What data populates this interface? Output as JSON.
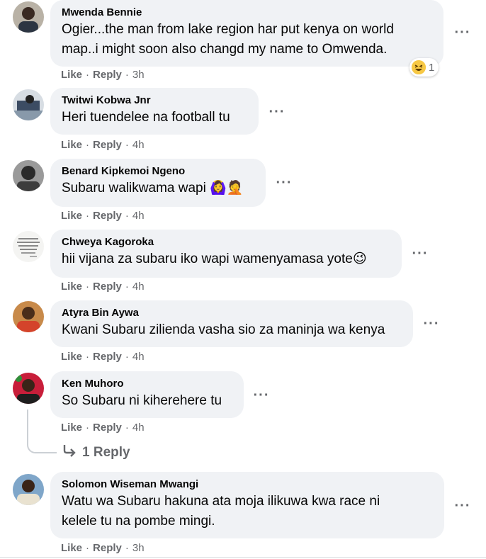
{
  "comments": [
    {
      "author": "Mwenda Bennie",
      "text_lines": [
        "Ogier...the man from lake region har put kenya on world",
        "map..i might soon also changd my name to Omwenda."
      ],
      "like": "Like",
      "reply": "Reply",
      "time": "3h",
      "reaction": {
        "icon": "laughing-emoji",
        "count": "1"
      }
    },
    {
      "author": "Twitwi Kobwa Jnr",
      "text_lines": [
        "Heri tuendelee na football tu"
      ],
      "like": "Like",
      "reply": "Reply",
      "time": "4h"
    },
    {
      "author": "Benard Kipkemoi Ngeno",
      "text_lines": [
        "Subaru walikwama wapi 🙆‍♀️🤦"
      ],
      "like": "Like",
      "reply": "Reply",
      "time": "4h"
    },
    {
      "author": "Chweya Kagoroka",
      "text_lines": [
        "hii vijana za subaru iko wapi wamenyamasa yote😉"
      ],
      "like": "Like",
      "reply": "Reply",
      "time": "4h"
    },
    {
      "author": "Atyra Bin Aywa",
      "text_lines": [
        "Kwani Subaru zilienda vasha sio za maninja wa kenya"
      ],
      "like": "Like",
      "reply": "Reply",
      "time": "4h"
    },
    {
      "author": "Ken Muhoro",
      "text_lines": [
        "So Subaru ni kiherehere tu"
      ],
      "like": "Like",
      "reply": "Reply",
      "time": "4h"
    },
    {
      "author": "Solomon Wiseman Mwangi",
      "text_lines": [
        "Watu wa Subaru hakuna ata moja ilikuwa kwa race ni",
        "kelele tu na pombe mingi."
      ],
      "like": "Like",
      "reply": "Reply",
      "time": "3h"
    }
  ],
  "replies_link": {
    "arrow_icon": "reply-arrow-icon",
    "label": "1 Reply"
  },
  "more_icon": "more-options-icon",
  "colors": {
    "bubble": "#f0f2f5",
    "meta": "#65676b",
    "text": "#050505"
  }
}
